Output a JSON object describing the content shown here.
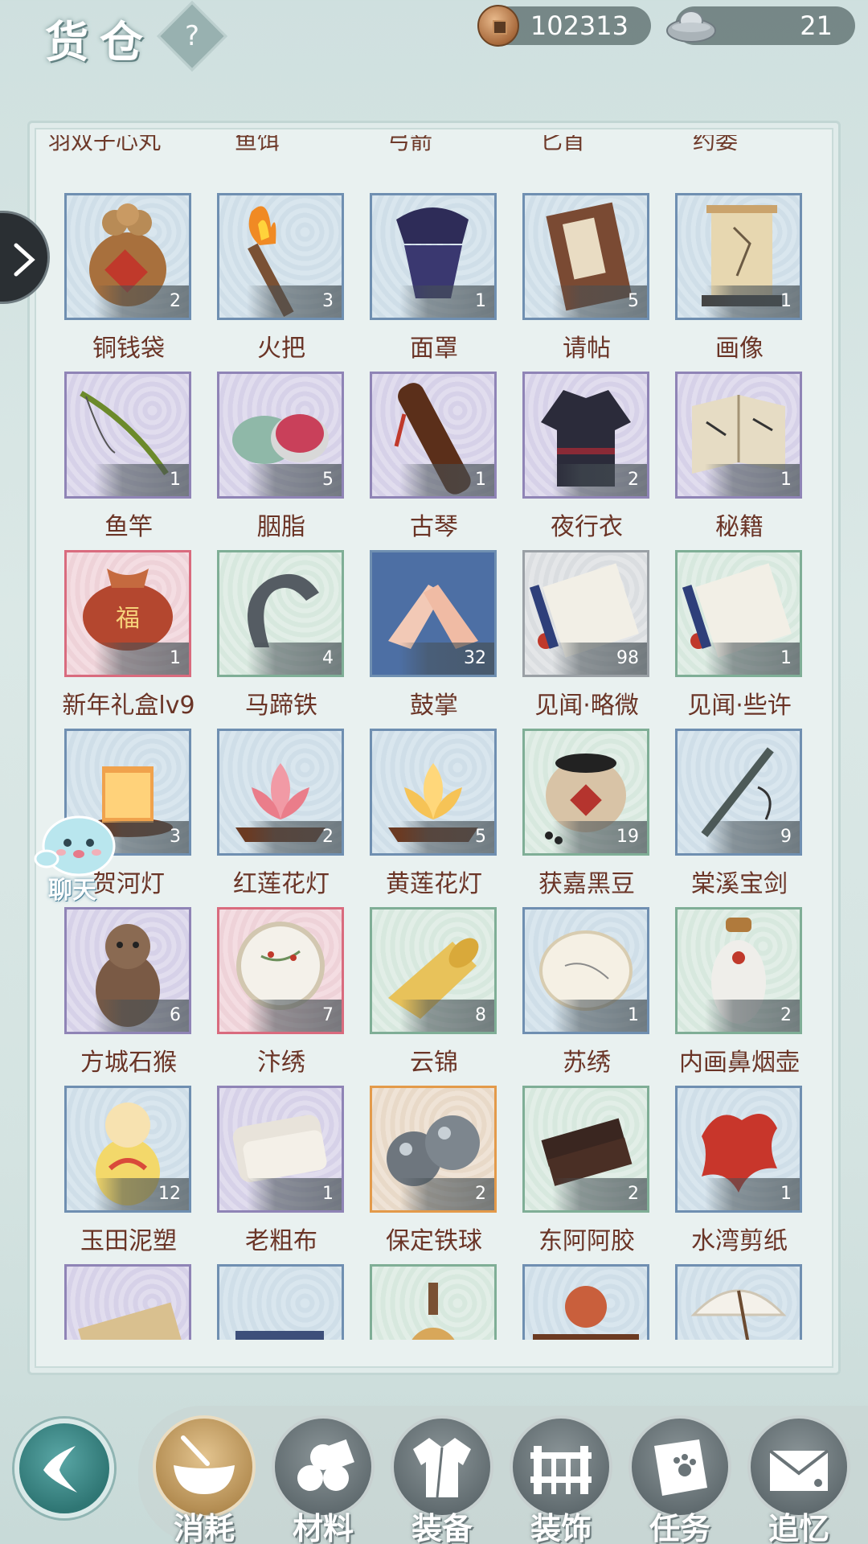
{
  "header": {
    "title": "货仓",
    "help": "?",
    "copper": {
      "icon": "copper-coin-icon",
      "value": "102313"
    },
    "silver": {
      "icon": "silver-ingot-icon",
      "value": "21"
    }
  },
  "partial_row": [
    "羽双子心丸",
    "鱼饵",
    "弓箭",
    "匕首",
    "约委"
  ],
  "items": [
    {
      "name": "铜钱袋",
      "count": "2",
      "rarity": "blue",
      "icon": "coin-pouch-icon"
    },
    {
      "name": "火把",
      "count": "3",
      "rarity": "blue",
      "icon": "torch-icon"
    },
    {
      "name": "面罩",
      "count": "1",
      "rarity": "blue",
      "icon": "mask-icon"
    },
    {
      "name": "请帖",
      "count": "5",
      "rarity": "blue",
      "icon": "invitation-icon"
    },
    {
      "name": "画像",
      "count": "1",
      "rarity": "blue",
      "icon": "portrait-scroll-icon"
    },
    {
      "name": "鱼竿",
      "count": "1",
      "rarity": "purple",
      "icon": "fishing-rod-icon"
    },
    {
      "name": "胭脂",
      "count": "5",
      "rarity": "purple",
      "icon": "rouge-box-icon"
    },
    {
      "name": "古琴",
      "count": "1",
      "rarity": "purple",
      "icon": "guqin-icon"
    },
    {
      "name": "夜行衣",
      "count": "2",
      "rarity": "purple",
      "icon": "night-robe-icon"
    },
    {
      "name": "秘籍",
      "count": "1",
      "rarity": "purple",
      "icon": "manual-icon"
    },
    {
      "name": "新年礼盒lv9",
      "count": "1",
      "rarity": "red",
      "icon": "gift-bag-icon"
    },
    {
      "name": "马蹄铁",
      "count": "4",
      "rarity": "green",
      "icon": "horseshoe-icon"
    },
    {
      "name": "鼓掌",
      "count": "32",
      "rarity": "blue",
      "icon": "clapping-hands-icon"
    },
    {
      "name": "见闻·略微",
      "count": "98",
      "rarity": "grey",
      "icon": "scroll-icon"
    },
    {
      "name": "见闻·些许",
      "count": "1",
      "rarity": "green",
      "icon": "scroll-icon"
    },
    {
      "name": "贺河灯",
      "count": "3",
      "rarity": "blue",
      "icon": "river-lantern-icon"
    },
    {
      "name": "红莲花灯",
      "count": "2",
      "rarity": "blue",
      "icon": "red-lotus-lamp-icon"
    },
    {
      "name": "黄莲花灯",
      "count": "5",
      "rarity": "blue",
      "icon": "yellow-lotus-lamp-icon"
    },
    {
      "name": "获嘉黑豆",
      "count": "19",
      "rarity": "green",
      "icon": "black-bean-jar-icon"
    },
    {
      "name": "棠溪宝剑",
      "count": "9",
      "rarity": "blue",
      "icon": "sword-icon"
    },
    {
      "name": "方城石猴",
      "count": "6",
      "rarity": "purple",
      "icon": "stone-monkey-icon"
    },
    {
      "name": "汴绣",
      "count": "7",
      "rarity": "red",
      "icon": "embroidery-hoop-icon"
    },
    {
      "name": "云锦",
      "count": "8",
      "rarity": "green",
      "icon": "brocade-roll-icon"
    },
    {
      "name": "苏绣",
      "count": "1",
      "rarity": "blue",
      "icon": "embroidery-cloth-icon"
    },
    {
      "name": "内画鼻烟壶",
      "count": "2",
      "rarity": "green",
      "icon": "snuff-bottle-icon"
    },
    {
      "name": "玉田泥塑",
      "count": "12",
      "rarity": "blue",
      "icon": "clay-doll-icon"
    },
    {
      "name": "老粗布",
      "count": "1",
      "rarity": "purple",
      "icon": "cloth-icon"
    },
    {
      "name": "保定铁球",
      "count": "2",
      "rarity": "orange",
      "icon": "iron-balls-icon"
    },
    {
      "name": "东阿阿胶",
      "count": "2",
      "rarity": "green",
      "icon": "ejiao-icon"
    },
    {
      "name": "水湾剪纸",
      "count": "1",
      "rarity": "blue",
      "icon": "paper-cut-icon"
    },
    {
      "name": "",
      "count": "",
      "rarity": "purple",
      "icon": "scroll-roll-icon"
    },
    {
      "name": "",
      "count": "",
      "rarity": "blue",
      "icon": "blue-cloth-icon"
    },
    {
      "name": "",
      "count": "",
      "rarity": "green",
      "icon": "gourd-icon"
    },
    {
      "name": "",
      "count": "",
      "rarity": "blue",
      "icon": "monkey-king-figure-icon"
    },
    {
      "name": "",
      "count": "",
      "rarity": "blue",
      "icon": "umbrella-icon"
    }
  ],
  "chat": {
    "label": "聊天"
  },
  "tabs": [
    {
      "label": "消耗",
      "icon": "bowl-icon",
      "active": true
    },
    {
      "label": "材料",
      "icon": "logs-icon",
      "active": false
    },
    {
      "label": "装备",
      "icon": "robe-icon",
      "active": false
    },
    {
      "label": "装饰",
      "icon": "fence-icon",
      "active": false
    },
    {
      "label": "任务",
      "icon": "task-book-icon",
      "active": false
    },
    {
      "label": "追忆",
      "icon": "letter-icon",
      "active": false
    }
  ],
  "colors": {
    "blue": "#6f8fb1",
    "purple": "#8f84b6",
    "green": "#7fae96",
    "red": "#d96b7e",
    "orange": "#e39a4a",
    "grey": "#9aa0a5",
    "item_name": "#6a3426"
  }
}
